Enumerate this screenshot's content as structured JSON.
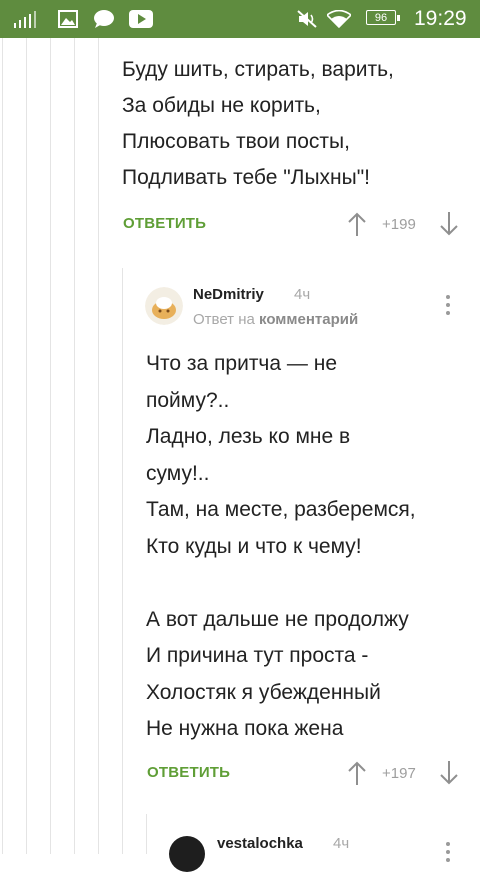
{
  "status_bar": {
    "battery": "96",
    "time": "19:29",
    "icons": [
      "signal-icon",
      "image-icon",
      "chat-bubble-icon",
      "youtube-icon",
      "mute-icon",
      "wifi-icon",
      "battery-icon"
    ]
  },
  "comment": {
    "lines": [
      "Буду шить, стирать, варить,",
      "За обиды не корить,",
      "Плюсовать твои посты,",
      "Подливать тебе \"Лыхны\"!"
    ],
    "reply_label": "ОТВЕТИТЬ",
    "rating": "+199"
  },
  "reply": {
    "author": "NeDmitriy",
    "time_ago": "4ч",
    "subline_prefix": "Ответ на",
    "subline_link": "комментарий",
    "text": "Что за притча — не\nпойму?..\nЛадно, лезь ко мне в\nсуму!..\nТам, на месте, разберемся,\nКто куды и что к чему!\n\nА вот дальше не продолжу\nИ причина тут проста -\nХолостяк я убежденный\nНе нужна пока жена",
    "reply_label": "ОТВЕТИТЬ",
    "rating": "+197"
  },
  "next_reply": {
    "author": "vestalochka",
    "time_ago": "4ч"
  },
  "colors": {
    "status_bar": "#5f8c3f",
    "accent_green": "#5f9e36",
    "muted": "#a8a8a8"
  }
}
